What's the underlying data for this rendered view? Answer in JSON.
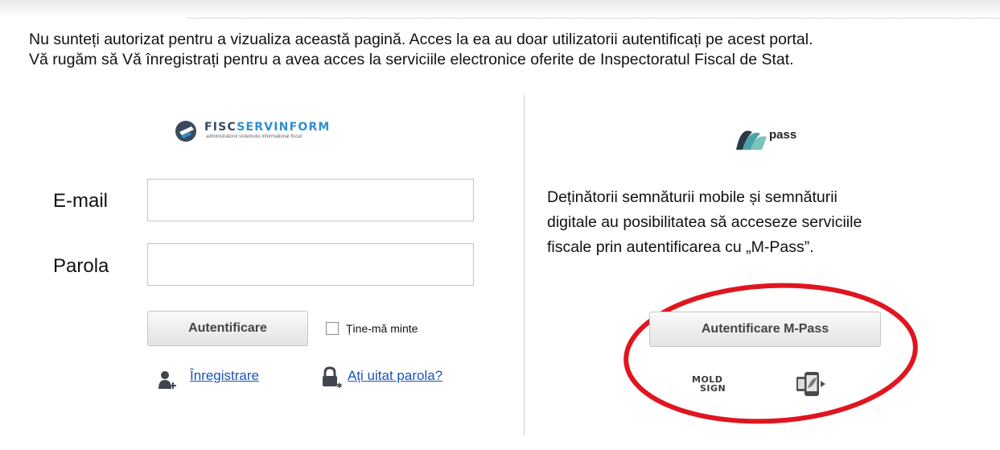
{
  "notice": {
    "line1": "Nu sunteți autorizat pentru a vizualiza această pagină. Acces la ea au doar utilizatorii autentificați pe acest portal.",
    "line2": "Vă rugăm să Vă înregistrați pentru a avea acces la serviciile electronice oferite de Inspectoratul Fiscal de Stat."
  },
  "login": {
    "logo": {
      "name_part1": "FISC",
      "name_part2": "SERVINFORM",
      "tagline": "administratorul sistemului informațional fiscal"
    },
    "email_label": "E-mail",
    "email_value": "",
    "password_label": "Parola",
    "password_value": "",
    "submit_label": "Autentificare",
    "remember_label": "Ține-mă minte",
    "register_link": "Înregistrare",
    "forgot_link": "Ați uitat parola?"
  },
  "mpass": {
    "logo_text": "pass",
    "description_line1": "Deținătorii semnăturii mobile și semnăturii",
    "description_line2": "digitale au posibilitatea să acceseze serviciile",
    "description_line3": "fiscale prin autentificarea cu „M-Pass”.",
    "button_label": "Autentificare M-Pass",
    "moldsign_line1": "MOLD",
    "moldsign_line2": "SIGN",
    "highlight_color": "#e0151f"
  },
  "colors": {
    "link": "#1a55b8",
    "accent_blue": "#2f8fd0"
  }
}
